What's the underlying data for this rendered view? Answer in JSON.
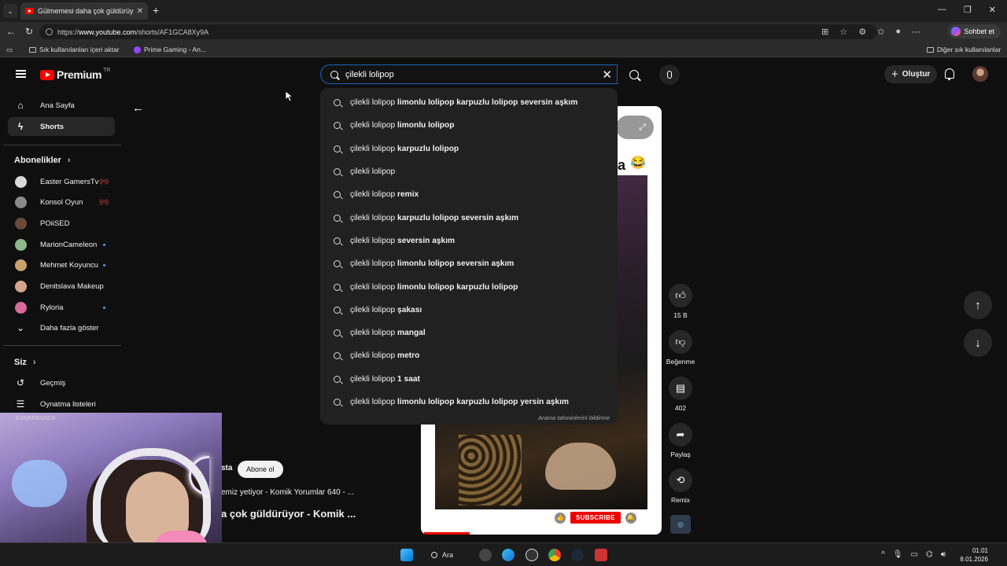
{
  "browser": {
    "tab_title": "Gülmemesi daha çok güldürüyor",
    "url_prefix": "https://",
    "url_host": "www.youtube.com",
    "url_path": "/shorts/AF1GCA8Xy9A",
    "chat_label": "Sohbet et",
    "bookmarks": {
      "import": "Sık kullanılanları içeri aktar",
      "prime": "Prime Gaming - An...",
      "other": "Diğer sık kullanılanlar"
    }
  },
  "youtube": {
    "logo_word": "Premium",
    "logo_region": "TR",
    "search_value": "çilekli lolipop",
    "create_label": "Oluştur"
  },
  "sidebar": {
    "home": "Ana Sayfa",
    "shorts": "Shorts",
    "subscriptions_header": "Abonelikler",
    "channels": [
      {
        "name": "Easter GamersTv",
        "status": "live",
        "color": "#d9d9d9"
      },
      {
        "name": "Konsol Oyun",
        "status": "live",
        "color": "#8a8a8a"
      },
      {
        "name": "POiiSED",
        "status": "",
        "color": "#6b4a3a"
      },
      {
        "name": "MarionCameleon",
        "status": "new",
        "color": "#8db88a"
      },
      {
        "name": "Mehmet Koyuncu",
        "status": "new",
        "color": "#c9a16a"
      },
      {
        "name": "Denitslava Makeup",
        "status": "",
        "color": "#d7a48c"
      },
      {
        "name": "Ryloria",
        "status": "new",
        "color": "#d96a9a"
      }
    ],
    "show_more": "Daha fazla göster",
    "you_header": "Siz",
    "history": "Geçmiş",
    "playlists": "Oynatma listeleri"
  },
  "suggestions": {
    "query": "çilekli lolipop",
    "items": [
      " limonlu lolipop karpuzlu lolipop seversin aşkım",
      " limonlu lolipop",
      " karpuzlu lolipop",
      "",
      " remix",
      " karpuzlu lolipop seversin aşkım",
      " seversin aşkım",
      " limonlu lolipop seversin aşkım",
      " limonlu lolipop karpuzlu lolipop",
      " şakası",
      " mangal",
      " metro",
      " 1 saat",
      " limonlu lolipop karpuzlu lolipop yersin aşkım"
    ],
    "report_text": "Arama tahminlerini bildirme"
  },
  "short": {
    "caption_letter": "a",
    "subscribe_overlay": "SUBSCRIBE",
    "likes": "15 B",
    "dislike_label": "Beğenme",
    "comments": "402",
    "share_label": "Paylaş",
    "remix_label": "Remix",
    "channel_partial": "sta",
    "subscribe_label": "Abone ol",
    "description_partial": "emiz yetiyor - Komik Yorumlar 640 - ...",
    "title_partial": "a çok güldürüyor - Komik ..."
  },
  "taskbar": {
    "search_label": "Ara",
    "time": "01:01",
    "date": "8.01.2026"
  },
  "webcam": {
    "chair_text": "GAMERBUNCH"
  }
}
